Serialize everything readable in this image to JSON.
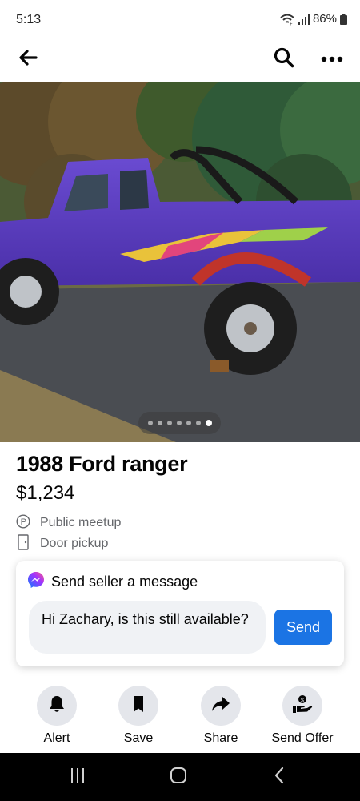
{
  "status_bar": {
    "time": "5:13",
    "battery": "86%"
  },
  "nav": {
    "back_icon": "arrow-left-icon",
    "search_icon": "search-icon",
    "more_icon": "more-horizontal-icon"
  },
  "photo": {
    "description_icon": "listing-photo",
    "page_count": 7,
    "active_page": 7
  },
  "listing": {
    "title": "1988 Ford ranger",
    "price": "$1,234",
    "options": [
      {
        "icon": "parking-icon",
        "label": "Public meetup"
      },
      {
        "icon": "door-icon",
        "label": "Door pickup"
      }
    ]
  },
  "message": {
    "header": "Send seller a message",
    "icon": "messenger-icon",
    "text": "Hi Zachary, is this still available?",
    "send_label": "Send",
    "colors": {
      "send_button": "#1b74e4"
    }
  },
  "actions": [
    {
      "icon": "bell-icon",
      "label": "Alert"
    },
    {
      "icon": "bookmark-icon",
      "label": "Save"
    },
    {
      "icon": "share-icon",
      "label": "Share"
    },
    {
      "icon": "send-offer-icon",
      "label": "Send Offer"
    }
  ],
  "system_nav": {
    "recent_icon": "recent-apps-icon",
    "home_icon": "home-icon",
    "back_icon": "system-back-icon"
  }
}
